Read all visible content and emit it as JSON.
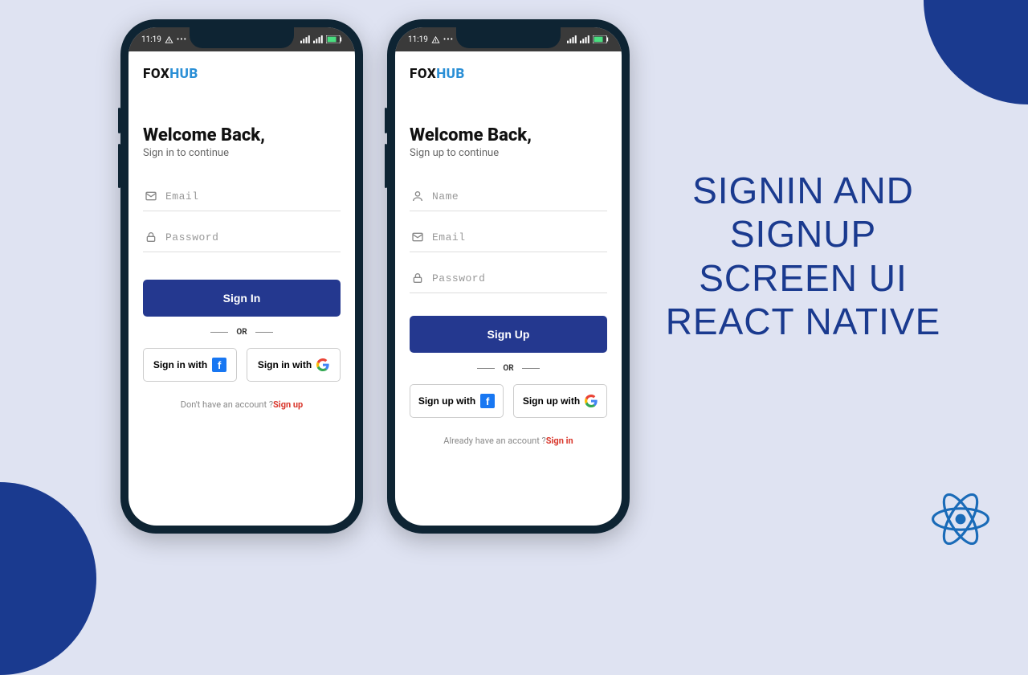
{
  "statusbar": {
    "time": "11:19"
  },
  "brand": {
    "part1": "FOX",
    "part2": "HUB"
  },
  "title": {
    "line1": "SIGNIN AND SIGNUP",
    "line2": "SCREEN UI",
    "line3": "REACT NATIVE"
  },
  "signin": {
    "heading": "Welcome Back,",
    "subtitle": "Sign in to continue",
    "email_placeholder": "Email",
    "password_placeholder": "Password",
    "primary": "Sign In",
    "or": "OR",
    "social_fb": "Sign in with",
    "social_google": "Sign in with",
    "footer_text": "Don't have an account ?",
    "footer_link": "Sign up"
  },
  "signup": {
    "heading": "Welcome Back,",
    "subtitle": "Sign up to continue",
    "name_placeholder": "Name",
    "email_placeholder": "Email",
    "password_placeholder": "Password",
    "primary": "Sign Up",
    "or": "OR",
    "social_fb": "Sign up with",
    "social_google": "Sign up with",
    "footer_text": "Already have an account ?",
    "footer_link": "Sign in"
  }
}
